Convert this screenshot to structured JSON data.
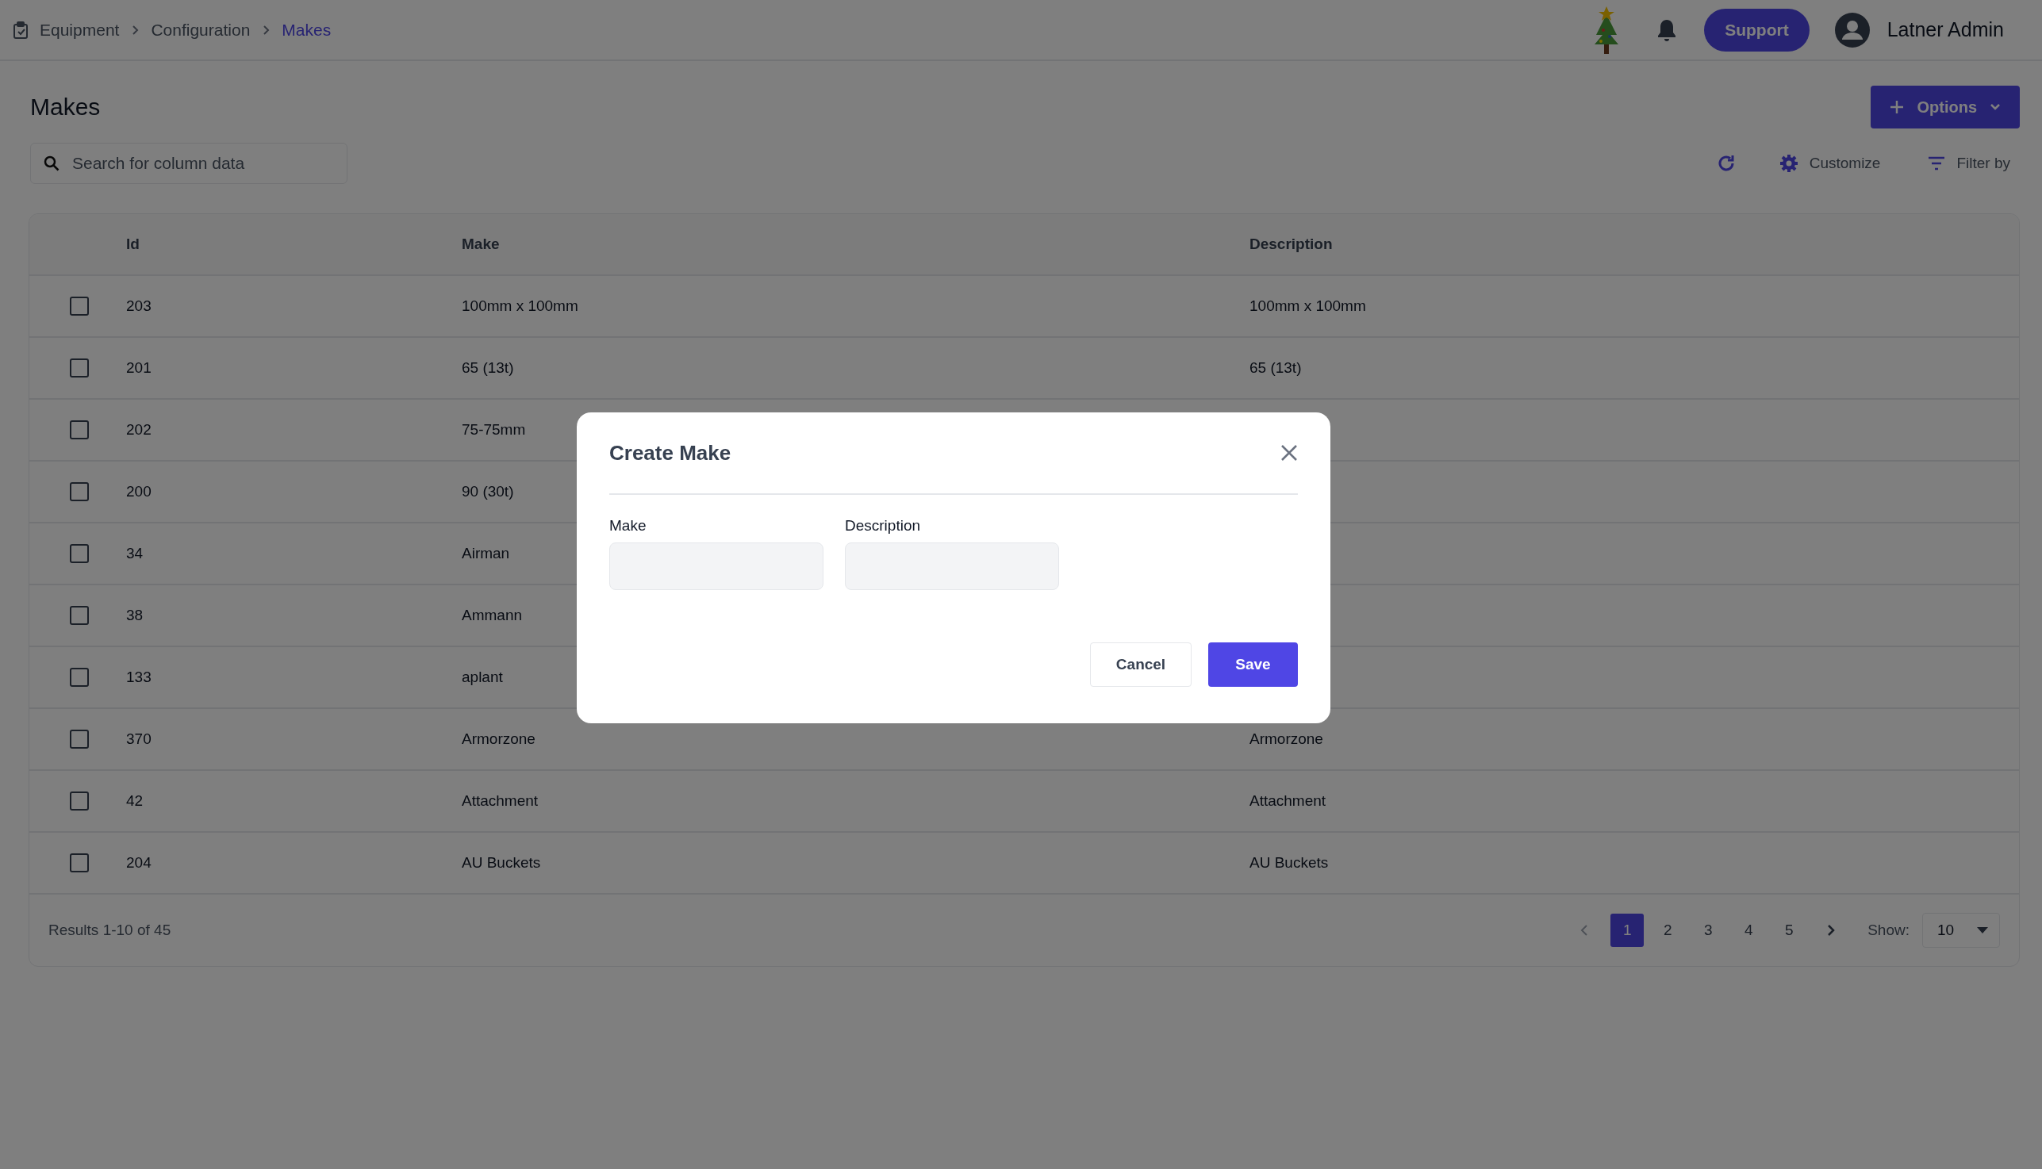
{
  "breadcrumb": [
    {
      "label": "Equipment",
      "current": false
    },
    {
      "label": "Configuration",
      "current": false
    },
    {
      "label": "Makes",
      "current": true
    }
  ],
  "header": {
    "support_button": "Support",
    "user_name": "Latner Admin"
  },
  "page": {
    "title": "Makes",
    "options_button": "Options",
    "search": {
      "placeholder": "Search for column data"
    },
    "customize_button": "Customize",
    "filter_button": "Filter by"
  },
  "table": {
    "columns": [
      "Id",
      "Make",
      "Description"
    ],
    "rows": [
      {
        "checked": false,
        "id": "203",
        "make": "100mm x 100mm",
        "description": "100mm x 100mm"
      },
      {
        "checked": false,
        "id": "201",
        "make": "65 (13t)",
        "description": "65 (13t)"
      },
      {
        "checked": false,
        "id": "202",
        "make": "75-75mm"
      },
      {
        "checked": false,
        "id": "200",
        "make": "90 (30t)"
      },
      {
        "checked": false,
        "id": "34",
        "make": "Airman"
      },
      {
        "checked": false,
        "id": "38",
        "make": "Ammann"
      },
      {
        "checked": false,
        "id": "133",
        "make": "aplant"
      },
      {
        "checked": false,
        "id": "370",
        "make": "Armorzone",
        "description": "Armorzone"
      },
      {
        "checked": false,
        "id": "42",
        "make": "Attachment",
        "description": "Attachment"
      },
      {
        "checked": false,
        "id": "204",
        "make": "AU Buckets",
        "description": "AU Buckets"
      }
    ],
    "results": "Results 1-10 of 45",
    "pages": [
      {
        "label": "1",
        "selected": true
      },
      {
        "label": "2",
        "selected": false
      },
      {
        "label": "3",
        "selected": false
      },
      {
        "label": "4",
        "selected": false
      },
      {
        "label": "5",
        "selected": false
      }
    ],
    "show_label": "Show:",
    "page_size": "10"
  },
  "modal": {
    "title": "Create Make",
    "fields": [
      {
        "label": "Make"
      },
      {
        "label": "Description"
      }
    ],
    "cancel_button": "Cancel",
    "save_button": "Save"
  }
}
